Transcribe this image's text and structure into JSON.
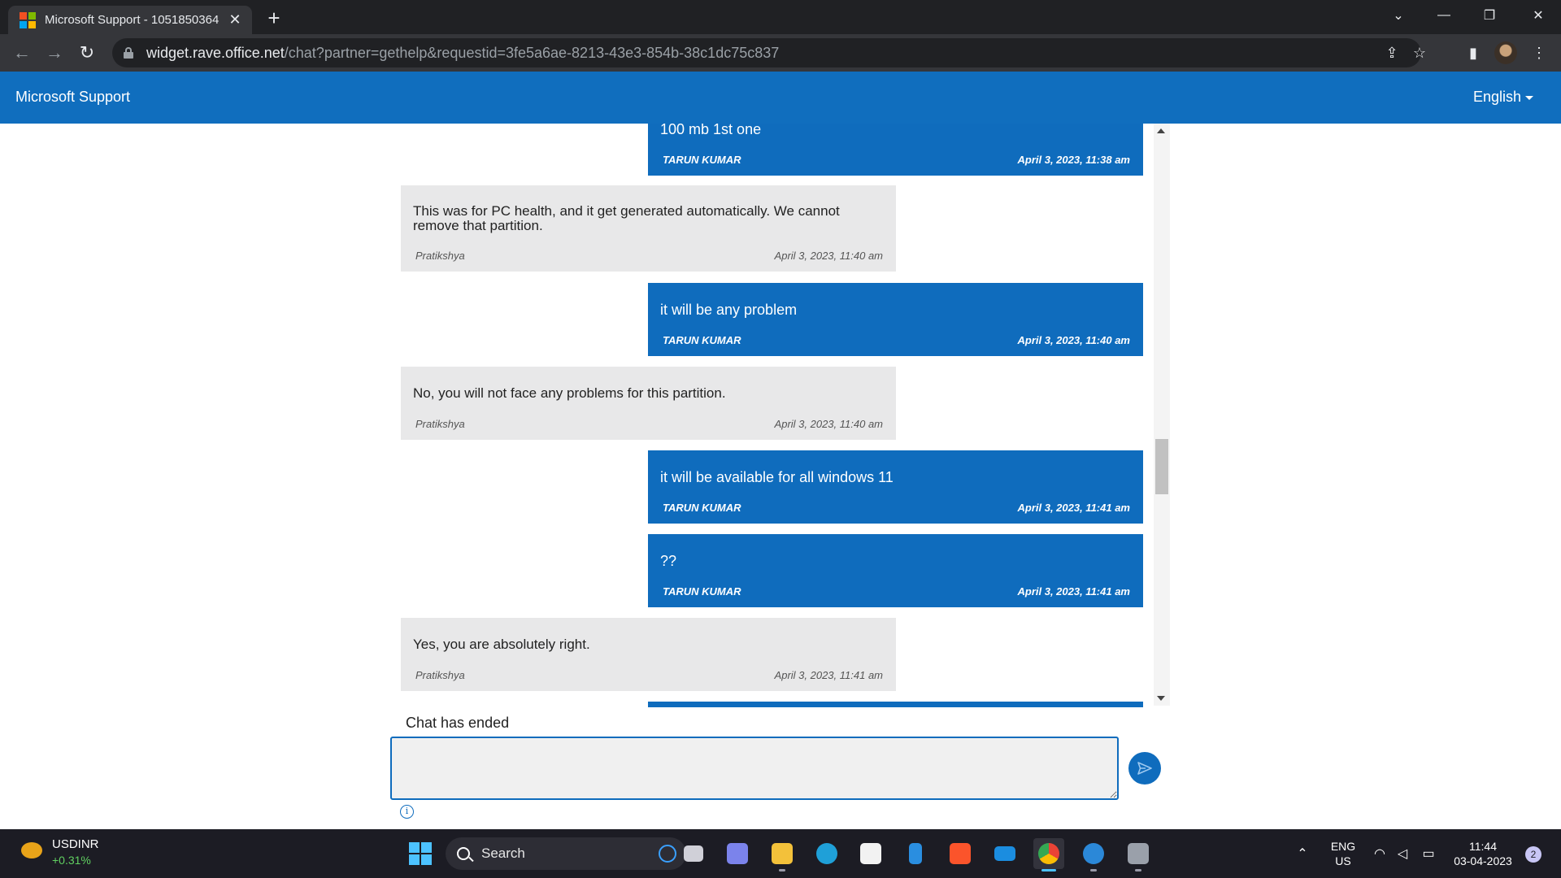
{
  "browser": {
    "tab_title": "Microsoft Support - 1051850364",
    "tab_close": "✕",
    "new_tab": "+",
    "url_host": "widget.rave.office.net",
    "url_path": "/chat?partner=gethelp&requestid=3fe5a6ae-8213-43e3-854b-38c1dc75c837"
  },
  "header": {
    "brand": "Microsoft Support",
    "language": "English"
  },
  "chat": {
    "messages": [
      {
        "role": "user",
        "text": "100 mb 1st one",
        "author": "TARUN KUMAR",
        "time": "April 3, 2023, 11:38 am"
      },
      {
        "role": "agent",
        "text": "This was for PC health, and it get generated automatically. We cannot remove that partition.",
        "author": "Pratikshya",
        "time": "April 3, 2023, 11:40 am"
      },
      {
        "role": "user",
        "text": "it will be any problem",
        "author": "TARUN KUMAR",
        "time": "April 3, 2023, 11:40 am"
      },
      {
        "role": "agent",
        "text": "No, you will not face any problems for this partition.",
        "author": "Pratikshya",
        "time": "April 3, 2023, 11:40 am"
      },
      {
        "role": "user",
        "text": "it will be available for all windows 11",
        "author": "TARUN KUMAR",
        "time": "April 3, 2023, 11:41 am"
      },
      {
        "role": "user",
        "text": "??",
        "author": "TARUN KUMAR",
        "time": "April 3, 2023, 11:41 am"
      },
      {
        "role": "agent",
        "text": "Yes, you are absolutely right.",
        "author": "Pratikshya",
        "time": "April 3, 2023, 11:41 am"
      }
    ],
    "ended_text": "Chat has ended",
    "input_value": ""
  },
  "taskbar": {
    "ticker_name": "USDINR",
    "ticker_change": "+0.31%",
    "search_label": "Search",
    "lang_line1": "ENG",
    "lang_line2": "US",
    "time": "11:44",
    "date": "03-04-2023",
    "notifications": "2"
  },
  "colors": {
    "brand_blue": "#106ebe",
    "user_bubble": "#0f6cbd",
    "agent_bubble": "#e8e8e9"
  }
}
